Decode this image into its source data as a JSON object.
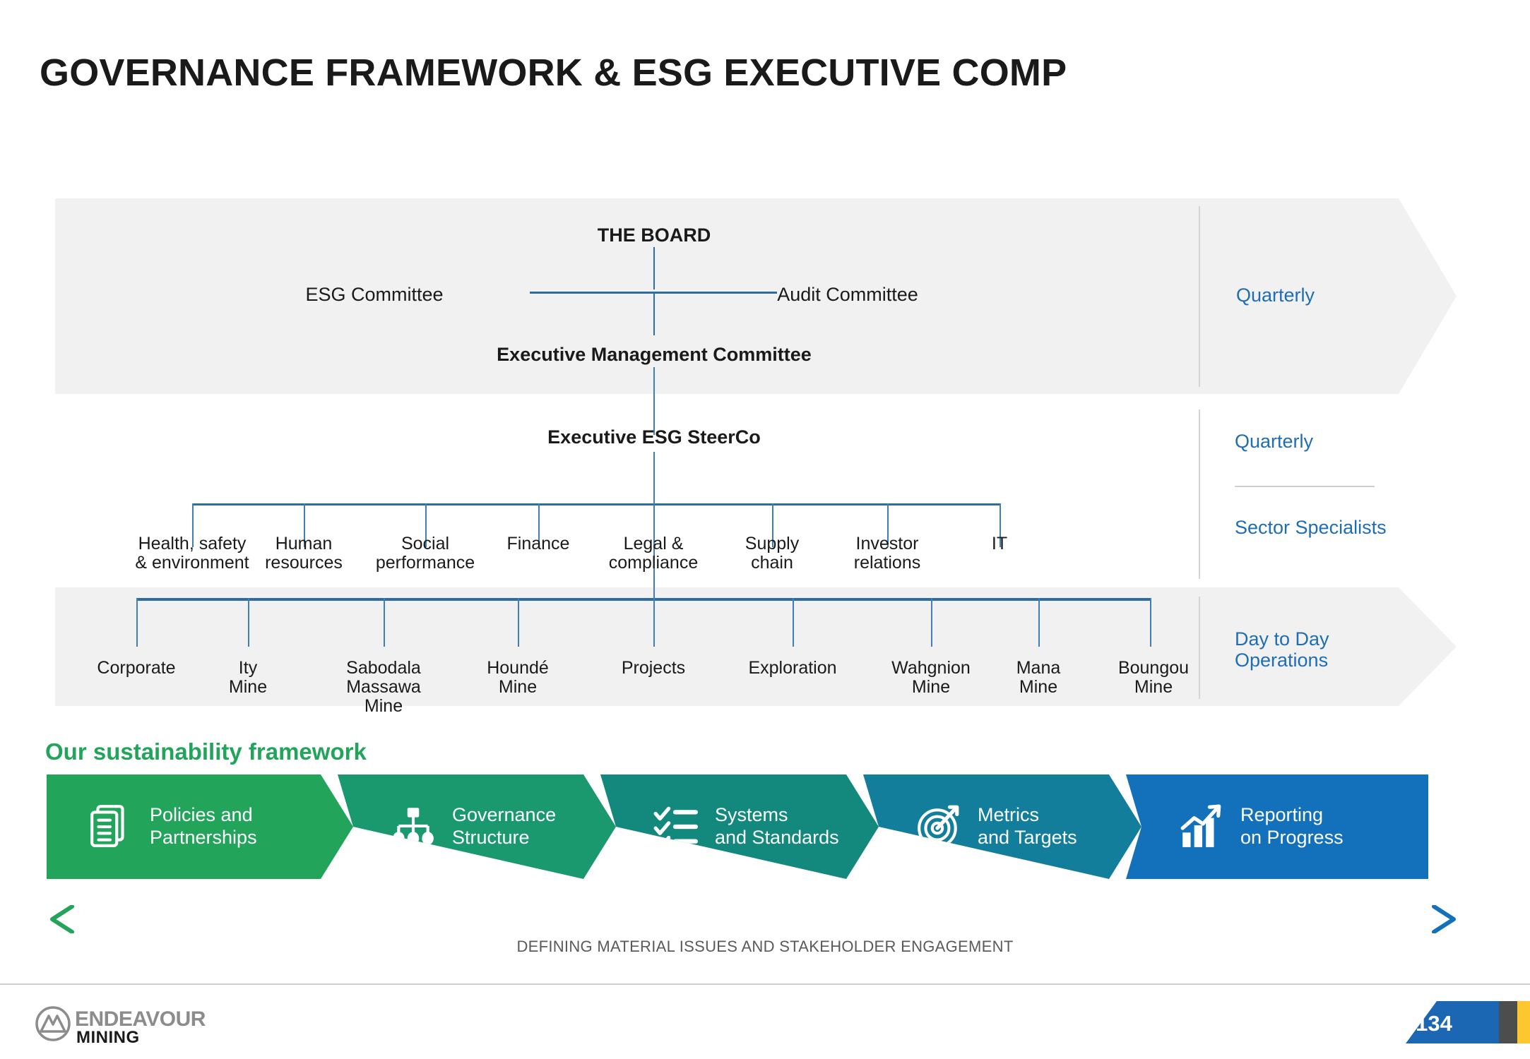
{
  "page_title": "GOVERNANCE FRAMEWORK & ESG EXECUTIVE COMP",
  "org_chart": {
    "board": "THE BOARD",
    "esg_committee": "ESG Committee",
    "audit_committee": "Audit Committee",
    "executive_management_committee": "Executive Management Committee",
    "executive_esg_steerco": "Executive ESG SteerCo",
    "departments": [
      {
        "line1": "Health, safety",
        "line2": "& environment"
      },
      {
        "line1": "Human",
        "line2": "resources"
      },
      {
        "line1": "Social",
        "line2": "performance"
      },
      {
        "line1": "Finance",
        "line2": ""
      },
      {
        "line1": "Legal &",
        "line2": "compliance"
      },
      {
        "line1": "Supply",
        "line2": "chain"
      },
      {
        "line1": "Investor",
        "line2": "relations"
      },
      {
        "line1": "IT",
        "line2": ""
      }
    ],
    "operations": [
      {
        "line1": "Corporate",
        "line2": "",
        "line3": ""
      },
      {
        "line1": "Ity",
        "line2": "Mine",
        "line3": ""
      },
      {
        "line1": "Sabodala",
        "line2": "Massawa",
        "line3": "Mine"
      },
      {
        "line1": "Houndé",
        "line2": "Mine",
        "line3": ""
      },
      {
        "line1": "Projects",
        "line2": "",
        "line3": ""
      },
      {
        "line1": "Exploration",
        "line2": "",
        "line3": ""
      },
      {
        "line1": "Wahgnion",
        "line2": "Mine",
        "line3": ""
      },
      {
        "line1": "Mana",
        "line2": "Mine",
        "line3": ""
      },
      {
        "line1": "Boungou",
        "line2": "Mine",
        "line3": ""
      }
    ]
  },
  "cadence": {
    "board_level": "Quarterly",
    "steerco_level": "Quarterly",
    "specialists": "Sector Specialists",
    "operations": "Day to Day\nOperations"
  },
  "sustainability_framework": {
    "heading": "Our sustainability framework",
    "steps": [
      {
        "label": "Policies and\nPartnerships",
        "icon": "documents-icon",
        "color": "#22a45a"
      },
      {
        "label": "Governance\nStructure",
        "icon": "org-chart-icon",
        "color": "#19996d"
      },
      {
        "label": "Systems\nand Standards",
        "icon": "checklist-icon",
        "color": "#13897e"
      },
      {
        "label": "Metrics\nand Targets",
        "icon": "target-icon",
        "color": "#127e9c"
      },
      {
        "label": "Reporting\non Progress",
        "icon": "bar-chart-up-icon",
        "color": "#1271ba"
      }
    ],
    "bottom_arrow_caption": "DEFINING MATERIAL ISSUES AND STAKEHOLDER ENGAGEMENT"
  },
  "footer": {
    "logo_primary": "ENDEAVOUR",
    "logo_secondary": "MINING",
    "page_number": "134",
    "badge_colors": {
      "blue": "#1b67b3",
      "dark": "#4d4d4d",
      "yellow": "#fdc82f"
    }
  },
  "colors": {
    "accent_blue": "#1f6db5",
    "line_blue": "#2e6da4",
    "band_grey": "#f1f1f1",
    "green": "#22a45a",
    "gradient_start": "#22a45a",
    "gradient_end": "#1271ba"
  }
}
